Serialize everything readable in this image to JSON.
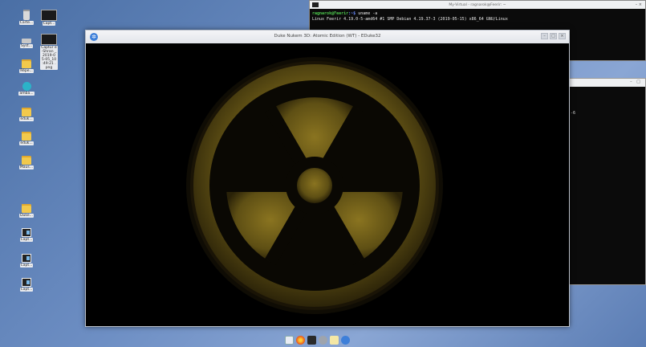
{
  "desktop": {
    "icons": [
      {
        "label": "Carte...",
        "kind": "trash"
      },
      {
        "label": "Capt...",
        "kind": "thumb"
      },
      {
        "label": "Syst...",
        "kind": "drive"
      },
      {
        "label": "Captur e-Shran _2019-0 5-05_10 :49:21 .png",
        "kind": "thumb"
      },
      {
        "label": "Répe...",
        "kind": "folder"
      },
      {
        "label": "amba...",
        "kind": "globe"
      },
      {
        "label": "eduk...",
        "kind": "folder"
      },
      {
        "label": "eduk...",
        "kind": "folder"
      },
      {
        "label": "Maus...",
        "kind": "folder"
      },
      {
        "label": "Duke...",
        "kind": "folder"
      },
      {
        "label": "Capt...",
        "kind": "capture"
      },
      {
        "label": "Capt...",
        "kind": "capture"
      },
      {
        "label": "Capt...",
        "kind": "capture"
      }
    ]
  },
  "terminal": {
    "title": "My-Virtual - ragnarok@Feerir: ~",
    "controls": "–   ×",
    "prompt_user": "ragnarok@Feerir",
    "prompt_path": ":~$",
    "command": " uname -a",
    "output": "Linux Feerir 4.19.0-5-amd64 #1 SMP Debian 4.19.37-3 (2019-05-15) x86_64 GNU/Linux"
  },
  "window2": {
    "controls": "–  □",
    "text": "-6"
  },
  "game_window": {
    "title": "Duke Nukem 3D: Atomic Edition (WT) - EDuke32",
    "icon": "eduke32-app-icon",
    "ctrl_min": "–",
    "ctrl_max": "□",
    "ctrl_close": "×"
  },
  "taskbar": {
    "items": [
      "file-manager-icon",
      "firefox-icon",
      "terminal-icon",
      "settings-icon",
      "text-editor-icon",
      "eduke32-icon"
    ]
  },
  "colors": {
    "terminal_green": "#4ec94e",
    "terminal_blue": "#6a8cff",
    "hazard_yellow": "#6b5a12",
    "desktop_blue": "#6e8fc4"
  }
}
